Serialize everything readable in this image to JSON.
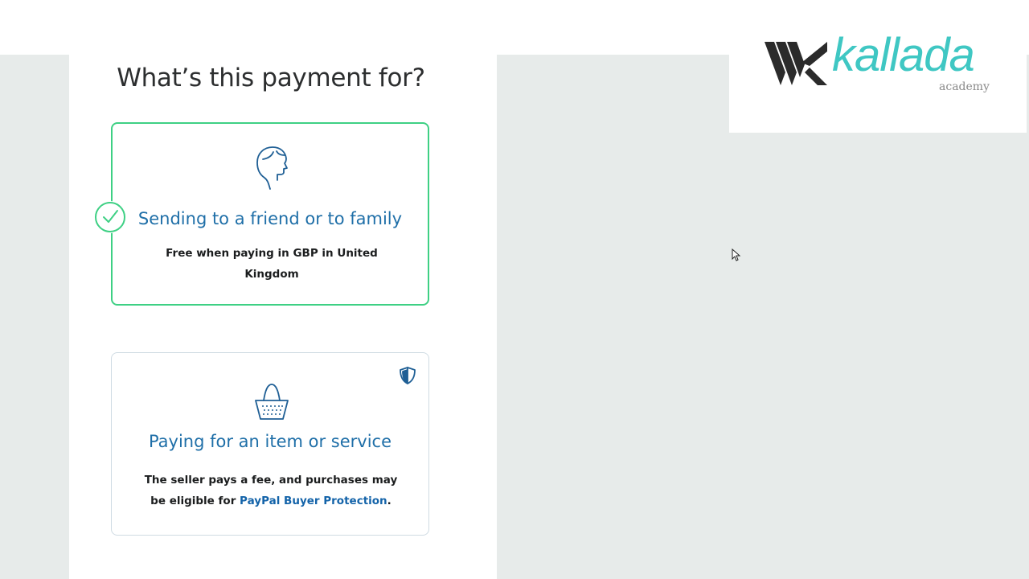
{
  "page": {
    "title": "What’s this payment for?"
  },
  "options": [
    {
      "title": "Sending to a friend or to family",
      "desc": "Free when paying in GBP in United Kingdom",
      "icon": "person-head-icon",
      "selected": true
    },
    {
      "title": "Paying for an item or service",
      "desc_prefix": "The seller pays a fee, and purchases may be eligible for ",
      "desc_link": "PayPal Buyer Protection",
      "desc_suffix": ".",
      "icon": "shopping-basket-icon",
      "badge_icon": "shield-icon",
      "selected": false
    }
  ],
  "logo": {
    "brand": "kallada",
    "sub": "academy"
  },
  "colors": {
    "selected_border": "#3ed084",
    "title_blue": "#1f6fa8",
    "link_blue": "#1363a9",
    "background_gray": "#e7ebea",
    "logo_teal": "#3fc7c3"
  }
}
